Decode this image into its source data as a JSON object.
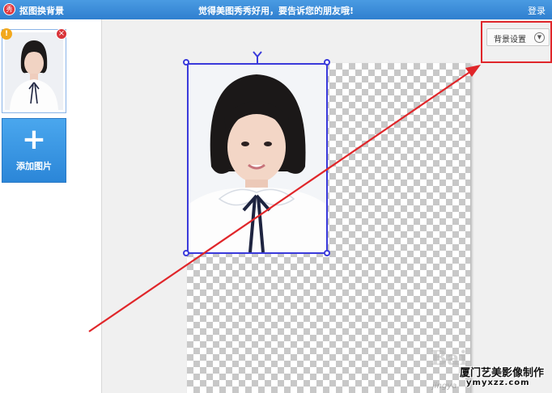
{
  "titlebar": {
    "logo_char": "秀",
    "app_title": "抠图换背景",
    "banner": "觉得美图秀秀好用，要告诉您的朋友哦!",
    "login": "登录"
  },
  "sidebar": {
    "thumb_warn": "!",
    "thumb_close": "×",
    "add_plus": "+",
    "add_label": "添加图片"
  },
  "toolbar": {
    "bg_settings_label": "背景设置"
  },
  "watermark": {
    "baidu": "Bai",
    "studio": "厦门艺美影像制作",
    "url": "ymyxzz.com",
    "jingyan": "jingya"
  },
  "colors": {
    "titlebar": "#2f7fcf",
    "selection": "#3a3adb",
    "annotation": "#e0262a"
  }
}
